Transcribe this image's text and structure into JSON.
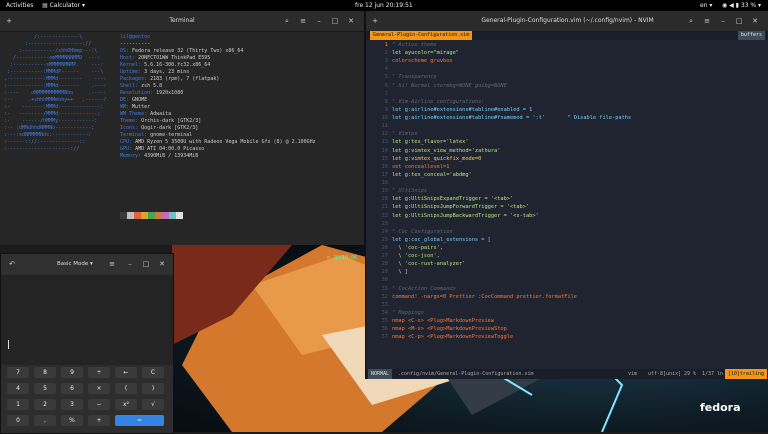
{
  "topbar": {
    "activities": "Activities",
    "app": "Calculator",
    "clock": "fre 12 jun  20:19:51",
    "lang": "en",
    "battery": "33 %"
  },
  "terminal": {
    "title": "Terminal",
    "user_host": "lil@gentoo",
    "ascii_art": [
      "          /:-------------\\",
      "       :------------------://",
      "     :-----------/shhOHbmp---:\\",
      "   /-----------omMMMNNNMMD  ---:",
      "  :-----------sMMMMNMNMP.    ---:",
      " :-----------:MMMdP------    ---\\",
      ",------------:MMMd--------    ---:",
      ":------------:MMMd-------    .---:",
      ":----    oNMMMMMMMMMNho     .----:",
      ":--     .+shhhMMMmhhy++   .------/",
      ":-    -------:MMMd--------------:",
      ":-   --------/MMMd-------------;",
      ":-    ------/hMMMy------------:",
      ":-- :dMNdhhdNMMNo------------;",
      ":---:sdNMMMMNds:------------:",
      ":------:://:-------------::",
      ":---------------------://"
    ],
    "info": [
      [
        "",
        "lil@gentoo"
      ],
      [
        "",
        "----------"
      ],
      [
        "OS: ",
        "Fedora release 32 (Thirty Two) x86_64"
      ],
      [
        "Host: ",
        "20NFCTO1WW ThinkPad E595"
      ],
      [
        "Kernel: ",
        "5.6.16-300.fc32.x86_64"
      ],
      [
        "Uptime: ",
        "3 days, 23 mins"
      ],
      [
        "Packages: ",
        "2183 (rpm), 7 (flatpak)"
      ],
      [
        "Shell: ",
        "zsh 5.8"
      ],
      [
        "Resolution: ",
        "1920x1080"
      ],
      [
        "DE: ",
        "GNOME"
      ],
      [
        "WM: ",
        "Mutter"
      ],
      [
        "WM Theme: ",
        "Adwaita"
      ],
      [
        "Theme: ",
        "Orchis-dark [GTK2/3]"
      ],
      [
        "Icons: ",
        "Qogir-dark [GTK2/3]"
      ],
      [
        "Terminal: ",
        "gnome-terminal"
      ],
      [
        "CPU: ",
        "AMD Ryzen 5 3500U with Radeon Vega Mobile Gfx (8) @ 2.100GHz"
      ],
      [
        "GPU: ",
        "AMD ATI 04:00.0 Picasso"
      ],
      [
        "Memory: ",
        "4390MiB / 13934MiB"
      ]
    ],
    "swatches": [
      "#3a3a3a",
      "#c0c0c0",
      "#e0663a",
      "#d4a62a",
      "#4fa04f",
      "#cf7a3a",
      "#c86ab5",
      "#6fc0c0",
      "#e0e0e0"
    ],
    "prompt": ">",
    "time": "20:18:06"
  },
  "nvim": {
    "title": "General-Plugin-Configuration.vim (~/.config/nvim) - NVIM",
    "tab_active": "General-Plugin-Configuration.vim",
    "tab_buffers": "buffers",
    "lines": [
      [
        "1",
        "\" Active theme",
        "com"
      ],
      [
        "2",
        "let ayucolor=\"mirage\"",
        "str"
      ],
      [
        "3",
        "colorscheme gruvbox",
        "kw"
      ],
      [
        "4",
        "",
        ""
      ],
      [
        "5",
        "\" Transparency",
        "com"
      ],
      [
        "6",
        "\" hi! Normal ctermbg=NONE guibg=NONE",
        "com"
      ],
      [
        "7",
        "",
        ""
      ],
      [
        "8",
        "\" Vim-Airline configurations:",
        "com"
      ],
      [
        "9",
        "let g:airline#extensions#tabline#enabled = 1",
        "var"
      ],
      [
        "10",
        "let g:airline#extensions#tabline#fnamemod = ':t'       \" Disable file-paths",
        "var"
      ],
      [
        "11",
        "",
        ""
      ],
      [
        "12",
        "\" Vimtex",
        "com"
      ],
      [
        "13",
        "let g:tex_flavor='latex'",
        "str"
      ],
      [
        "14",
        "let g:vimtex_view_method='zathura'",
        "str"
      ],
      [
        "15",
        "let g:vimtex_quickfix_mode=0",
        "num"
      ],
      [
        "16",
        "set conceallevel=1",
        "kw"
      ],
      [
        "17",
        "let g:tex_conceal='abdmg'",
        "str"
      ],
      [
        "18",
        "",
        ""
      ],
      [
        "19",
        "\" UltiSnips",
        "com"
      ],
      [
        "20",
        "let g:UltiSnipsExpandTrigger = '<tab>'",
        "str"
      ],
      [
        "21",
        "let g:UltiSnipsJumpForwardTrigger = '<tab>'",
        "str"
      ],
      [
        "22",
        "let g:UltiSnipsJumpBackwardTrigger = '<s-tab>'",
        "str"
      ],
      [
        "23",
        "",
        ""
      ],
      [
        "24",
        "\" Coc Configuration",
        "com"
      ],
      [
        "25",
        "let g:coc_global_extensions = [",
        "var"
      ],
      [
        "26",
        "  \\ 'coc-pairs',",
        "str"
      ],
      [
        "27",
        "  \\ 'coc-json',",
        "str"
      ],
      [
        "28",
        "  \\ 'coc-rust-analyzer'",
        "str"
      ],
      [
        "29",
        "  \\ ]",
        ""
      ],
      [
        "30",
        "",
        ""
      ],
      [
        "31",
        "\" CocAction Commands",
        "com"
      ],
      [
        "32",
        "command! -nargs=0 Prettier :CocCommand prettier.formatFile",
        "kw"
      ],
      [
        "33",
        "",
        ""
      ],
      [
        "34",
        "\" Mappings",
        "com"
      ],
      [
        "35",
        "nmap <C-s> <Plug>MarkdownPreview",
        "kw"
      ],
      [
        "36",
        "nmap <M-s> <Plug>MarkdownPreviewStop",
        "kw"
      ],
      [
        "37",
        "nmap <C-p> <Plug>MarkdownPreviewToggle",
        "kw"
      ]
    ],
    "status_mode": "NORMAL",
    "status_file": ".config/nvim/General-Plugin-Configuration.vim",
    "status_ft": "vim",
    "status_enc": "utf-8[unix]",
    "status_pct": "29 %",
    "status_pos": "1/37 ln : 1",
    "status_trail": "[10]trailing"
  },
  "calculator": {
    "mode": "Basic Mode",
    "keys": [
      [
        "7",
        "8",
        "9",
        "÷",
        "←",
        "C"
      ],
      [
        "4",
        "5",
        "6",
        "×",
        "(",
        ")"
      ],
      [
        "1",
        "2",
        "3",
        "−",
        "x²",
        "√"
      ],
      [
        "0",
        ",",
        "%",
        "+",
        "="
      ]
    ]
  },
  "desktop": {
    "logo": "fedora"
  }
}
